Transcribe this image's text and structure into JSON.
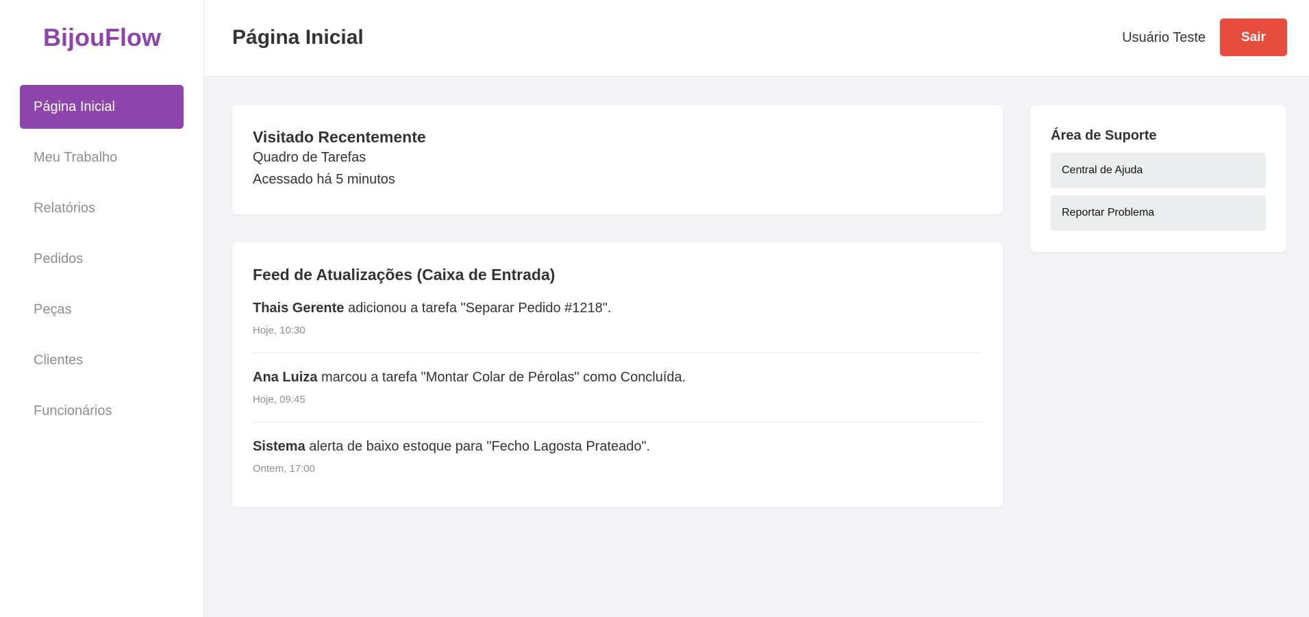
{
  "app": {
    "logo": "BijouFlow",
    "colors": {
      "accent": "#8e44ad",
      "danger": "#e74c3c",
      "background": "#f3f3f7"
    }
  },
  "sidebar": {
    "items": [
      {
        "label": "Página Inicial",
        "active": true
      },
      {
        "label": "Meu Trabalho",
        "active": false
      },
      {
        "label": "Relatórios",
        "active": false
      },
      {
        "label": "Pedidos",
        "active": false
      },
      {
        "label": "Peças",
        "active": false
      },
      {
        "label": "Clientes",
        "active": false
      },
      {
        "label": "Funcionários",
        "active": false
      }
    ]
  },
  "header": {
    "title": "Página Inicial",
    "user_name": "Usuário Teste",
    "logout_label": "Sair"
  },
  "recent": {
    "title": "Visitado Recentemente",
    "item": "Quadro de Tarefas",
    "accessed": "Acessado há 5 minutos"
  },
  "feed": {
    "title": "Feed de Atualizações (Caixa de Entrada)",
    "items": [
      {
        "actor": "Thais Gerente",
        "text": " adicionou a tarefa \"Separar Pedido #1218\".",
        "time": "Hoje, 10:30"
      },
      {
        "actor": "Ana Luiza",
        "text": " marcou a tarefa \"Montar Colar de Pérolas\" como Concluída.",
        "time": "Hoje, 09:45"
      },
      {
        "actor": "Sistema",
        "text": " alerta de baixo estoque para \"Fecho Lagosta Prateado\".",
        "time": "Ontem, 17:00"
      }
    ]
  },
  "support": {
    "title": "Área de Suporte",
    "links": [
      {
        "label": "Central de Ajuda"
      },
      {
        "label": "Reportar Problema"
      }
    ]
  }
}
